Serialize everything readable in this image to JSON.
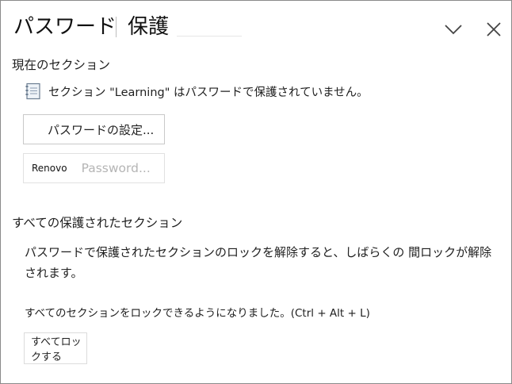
{
  "pane": {
    "title": "パスワード",
    "title_part2": "保護"
  },
  "icons": {
    "collapse": "chevron-down-icon",
    "close": "close-icon",
    "section": "notebook-section-icon"
  },
  "current_section": {
    "heading": "現在のセクション",
    "status": "セクション \"Learning\" はパスワードで保護されていません。",
    "set_password_label": "パスワードの設定...",
    "remove_prefix": "Renovo",
    "remove_label": "Password..."
  },
  "all_sections": {
    "heading": "すべての保護されたセクション",
    "description": "パスワードで保護されたセクションのロックを解除すると、しばらくの 間ロックが解除されます。",
    "lock_note": "すべてのセクションをロックできるようになりました。(Ctrl + Alt + L)",
    "lock_all_label": "すべてロックする"
  },
  "colors": {
    "border": "#8a8a8a",
    "button_border": "#c9c9c9",
    "disabled_text": "#b5b5b5",
    "text": "#1f1f1f"
  }
}
